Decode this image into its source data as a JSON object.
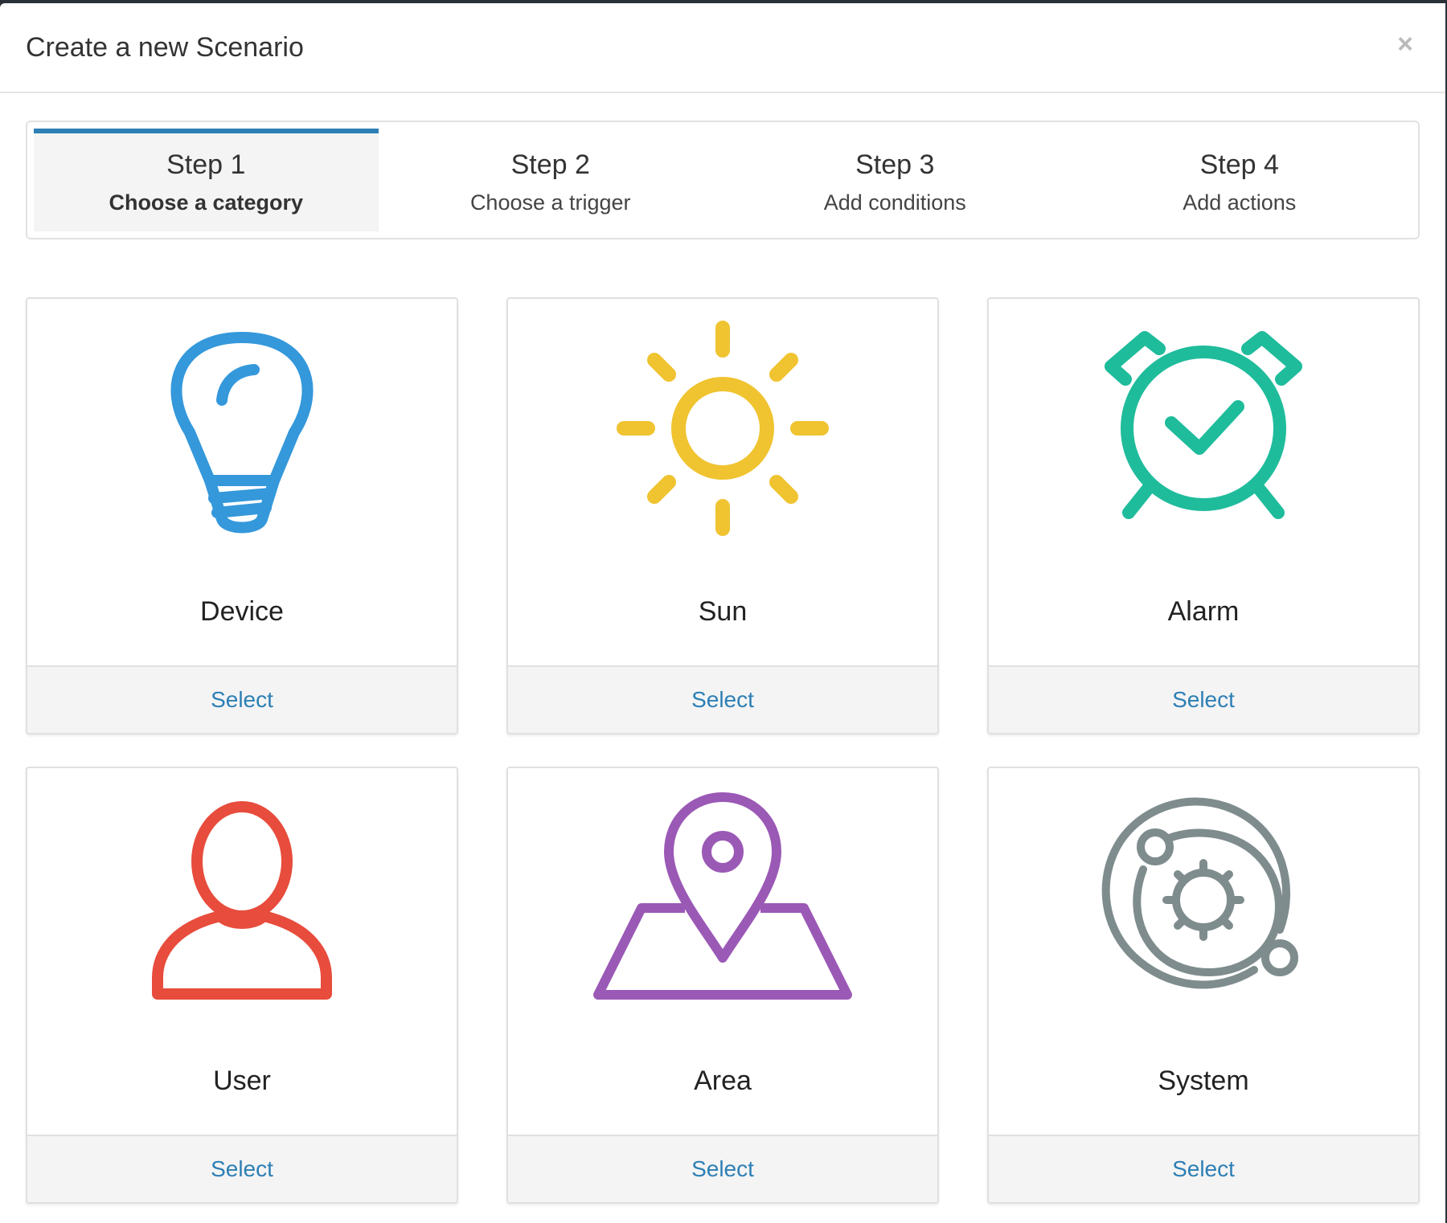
{
  "modal": {
    "title": "Create a new Scenario",
    "close_symbol": "×"
  },
  "steps": [
    {
      "label": "Step 1",
      "description": "Choose a category",
      "active": true
    },
    {
      "label": "Step 2",
      "description": "Choose a trigger",
      "active": false
    },
    {
      "label": "Step 3",
      "description": "Add conditions",
      "active": false
    },
    {
      "label": "Step 4",
      "description": "Add actions",
      "active": false
    }
  ],
  "categories": [
    {
      "name": "Device",
      "icon": "lightbulb-icon",
      "color": "#3498db",
      "action": "Select"
    },
    {
      "name": "Sun",
      "icon": "sun-icon",
      "color": "#f0c330",
      "action": "Select"
    },
    {
      "name": "Alarm",
      "icon": "alarm-clock-icon",
      "color": "#1fbc9c",
      "action": "Select"
    },
    {
      "name": "User",
      "icon": "user-icon",
      "color": "#e74c3c",
      "action": "Select"
    },
    {
      "name": "Area",
      "icon": "map-pin-icon",
      "color": "#9b59b6",
      "action": "Select"
    },
    {
      "name": "System",
      "icon": "system-orbit-icon",
      "color": "#7f8c8d",
      "action": "Select"
    }
  ],
  "colors": {
    "accent": "#2d7fb5",
    "active_step_bg": "#f4f4f4"
  }
}
